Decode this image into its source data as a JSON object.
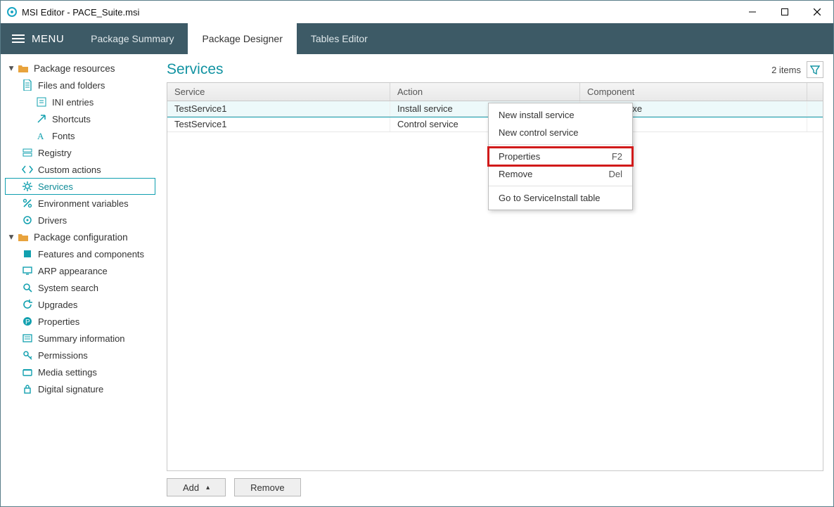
{
  "window": {
    "title": "MSI Editor - PACE_Suite.msi"
  },
  "menu_label": "MENU",
  "tabs": {
    "summary": "Package Summary",
    "designer": "Package Designer",
    "tables": "Tables Editor"
  },
  "sidebar": {
    "group_resources": "Package resources",
    "files_folders": "Files and folders",
    "ini_entries": "INI entries",
    "shortcuts": "Shortcuts",
    "fonts": "Fonts",
    "registry": "Registry",
    "custom_actions": "Custom actions",
    "services": "Services",
    "env_vars": "Environment variables",
    "drivers": "Drivers",
    "group_config": "Package configuration",
    "features_components": "Features and components",
    "arp_appearance": "ARP appearance",
    "system_search": "System search",
    "upgrades": "Upgrades",
    "properties": "Properties",
    "summary_info": "Summary information",
    "permissions": "Permissions",
    "media_settings": "Media settings",
    "digital_signature": "Digital signature"
  },
  "page": {
    "title": "Services",
    "items_count": "2 items"
  },
  "grid": {
    "header": {
      "service": "Service",
      "action": "Action",
      "component": "Component"
    },
    "rows": [
      {
        "service": "TestService1",
        "action": "Install service",
        "component": "Launcher.exe"
      },
      {
        "service": "TestService1",
        "action": "Control service",
        "component": ""
      }
    ]
  },
  "footer": {
    "add": "Add",
    "remove": "Remove"
  },
  "ctx": {
    "new_install": "New install service",
    "new_control": "New control service",
    "properties": "Properties",
    "properties_key": "F2",
    "remove": "Remove",
    "remove_key": "Del",
    "goto": "Go to ServiceInstall table"
  }
}
